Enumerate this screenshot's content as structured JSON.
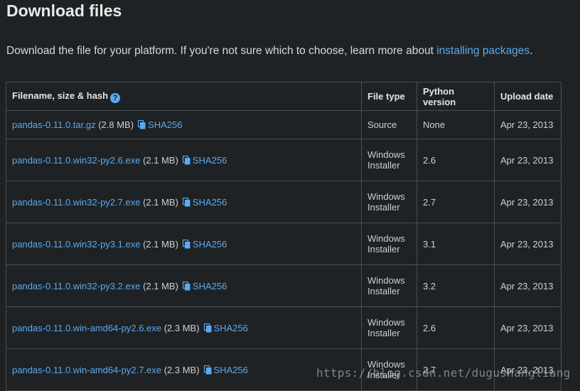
{
  "heading": "Download files",
  "intro": {
    "text": "Download the file for your platform. If you're not sure which to choose, learn more about ",
    "link_label": "installing packages",
    "suffix": "."
  },
  "table": {
    "headers": {
      "filename": "Filename, size & hash",
      "help_icon": "?",
      "file_type": "File type",
      "python_version": "Python version",
      "upload_date": "Upload date"
    },
    "hash_label": "SHA256",
    "rows": [
      {
        "filename": "pandas-0.11.0.tar.gz",
        "size": "(2.8 MB)",
        "file_type": "Source",
        "python_version": "None",
        "upload_date": "Apr 23, 2013"
      },
      {
        "filename": "pandas-0.11.0.win32-py2.6.exe",
        "size": "(2.1 MB)",
        "file_type": "Windows Installer",
        "python_version": "2.6",
        "upload_date": "Apr 23, 2013"
      },
      {
        "filename": "pandas-0.11.0.win32-py2.7.exe",
        "size": "(2.1 MB)",
        "file_type": "Windows Installer",
        "python_version": "2.7",
        "upload_date": "Apr 23, 2013"
      },
      {
        "filename": "pandas-0.11.0.win32-py3.1.exe",
        "size": "(2.1 MB)",
        "file_type": "Windows Installer",
        "python_version": "3.1",
        "upload_date": "Apr 23, 2013"
      },
      {
        "filename": "pandas-0.11.0.win32-py3.2.exe",
        "size": "(2.1 MB)",
        "file_type": "Windows Installer",
        "python_version": "3.2",
        "upload_date": "Apr 23, 2013"
      },
      {
        "filename": "pandas-0.11.0.win-amd64-py2.6.exe",
        "size": "(2.3 MB)",
        "file_type": "Windows Installer",
        "python_version": "2.6",
        "upload_date": "Apr 23, 2013"
      },
      {
        "filename": "pandas-0.11.0.win-amd64-py2.7.exe",
        "size": "(2.3 MB)",
        "file_type": "Windows Installer",
        "python_version": "2.7",
        "upload_date": "Apr 23, 2013"
      }
    ]
  },
  "watermark": "https://blog.csdn.net/dugushangliang",
  "colors": {
    "background": "#1f2224",
    "link": "#5aaaf0",
    "border": "#4c4f52"
  },
  "icons": {
    "help": "question-circle-icon",
    "copy": "copy-icon"
  }
}
